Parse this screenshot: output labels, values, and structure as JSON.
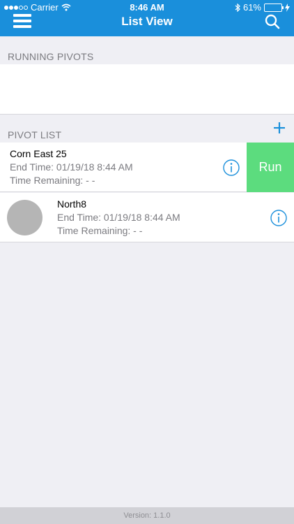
{
  "status_bar": {
    "carrier": "Carrier",
    "time": "8:46 AM",
    "battery": "61%",
    "battery_level": 0.61
  },
  "nav": {
    "title": "List View",
    "menu_icon": "hamburger-menu-icon",
    "search_icon": "search-icon"
  },
  "sections": {
    "running_label": "RUNNING PIVOTS",
    "list_label": "PIVOT LIST",
    "add_icon": "plus-icon"
  },
  "pivots": [
    {
      "name": "Corn East 25",
      "end_time": "End Time: 01/19/18 8:44 AM",
      "remaining": "Time Remaining: - -",
      "action_label": "Run"
    },
    {
      "name": "North8",
      "end_time": "End Time: 01/19/18 8:44 AM",
      "remaining": "Time Remaining: - -"
    }
  ],
  "footer": {
    "version": "Version: 1.1.0"
  },
  "colors": {
    "header": "#1a8fdb",
    "run": "#5cdc7e",
    "info": "#1a8fdb",
    "background": "#efeff4"
  }
}
